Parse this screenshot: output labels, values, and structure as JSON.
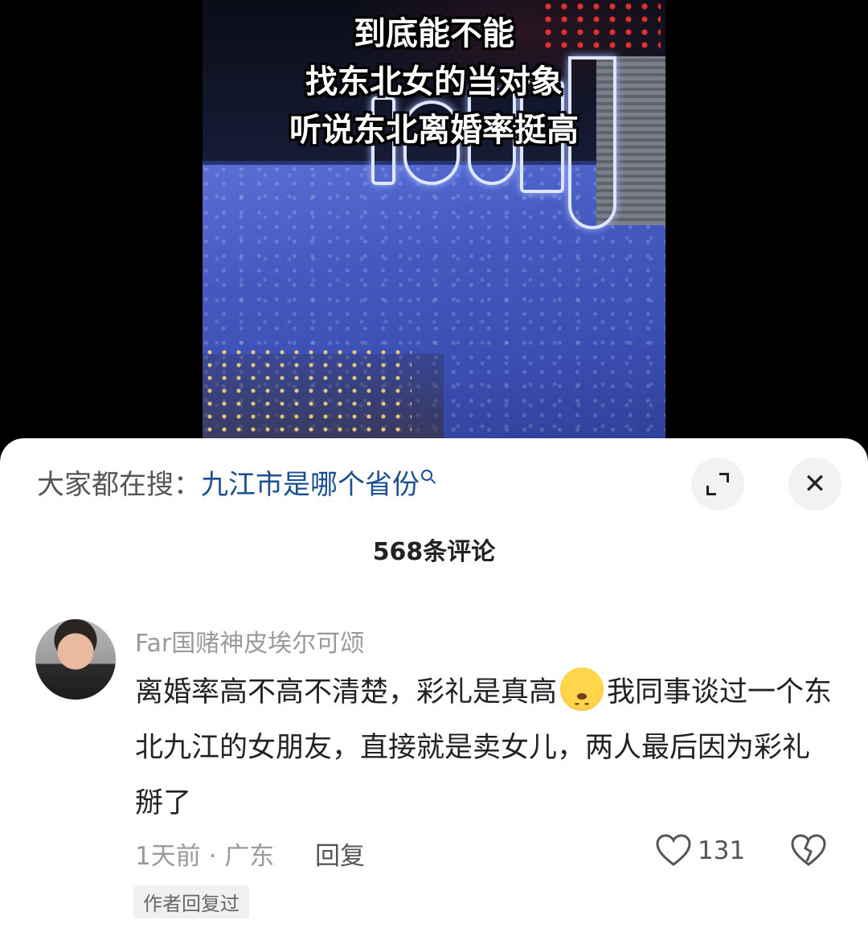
{
  "video": {
    "caption_lines": [
      "到底能不能",
      "找东北女的当对象",
      "听说东北离婚率挺高"
    ]
  },
  "sheet": {
    "search_prefix": "大家都在搜：",
    "search_term": "九江市是哪个省份",
    "comment_count": "568条评论"
  },
  "comment": {
    "username": "Far国赌神皮埃尔可颂",
    "text_part1": "离婚率高不高不清楚，彩礼是真高",
    "text_part2": "我同事谈过一个东北九江的女朋友，直接就是卖女儿，两人最后因为彩礼掰了",
    "meta": "1天前 · 广东",
    "reply_label": "回复",
    "likes": "131",
    "author_tag": "作者回复过"
  },
  "icons": {
    "expand": "expand-icon",
    "close": "close-icon",
    "like": "heart-icon",
    "dislike": "broken-heart-icon",
    "search": "search-icon"
  },
  "colors": {
    "search_term": "#1a4f91",
    "muted_text": "#9a9a9a",
    "sheet_bg": "#ffffff"
  }
}
